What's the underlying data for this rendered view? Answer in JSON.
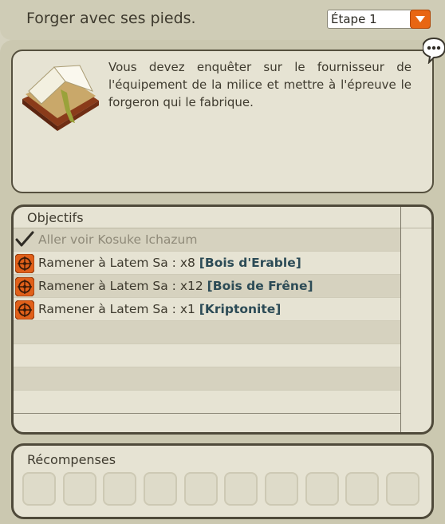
{
  "header": {
    "title": "Forger avec ses pieds.",
    "step_selected": "Étape 1"
  },
  "description": {
    "text": "Vous devez enquêter sur le fournisseur de l'équipement de la milice et mettre à l'épreuve le forgeron qui le fabrique.",
    "icon": "book-icon"
  },
  "objectives": {
    "title": "Objectifs",
    "items": [
      {
        "text": "Aller voir Kosuke Ichazum",
        "state": "done",
        "icon": "checkmark-icon"
      },
      {
        "text": "Ramener à Latem Sa : x8 ",
        "item": "[Bois d'Erable]",
        "state": "active",
        "icon": "compass-icon"
      },
      {
        "text": "Ramener à Latem Sa : x12 ",
        "item": "[Bois de Frêne]",
        "state": "active",
        "icon": "compass-icon"
      },
      {
        "text": "Ramener à Latem Sa : x1 ",
        "item": "[Kriptonite]",
        "state": "active",
        "icon": "compass-icon"
      }
    ]
  },
  "rewards": {
    "title": "Récompenses",
    "slot_count": 10
  },
  "colors": {
    "accent_orange": "#e86613",
    "item_link": "#2c4b56",
    "done_text": "#8f8a79"
  }
}
